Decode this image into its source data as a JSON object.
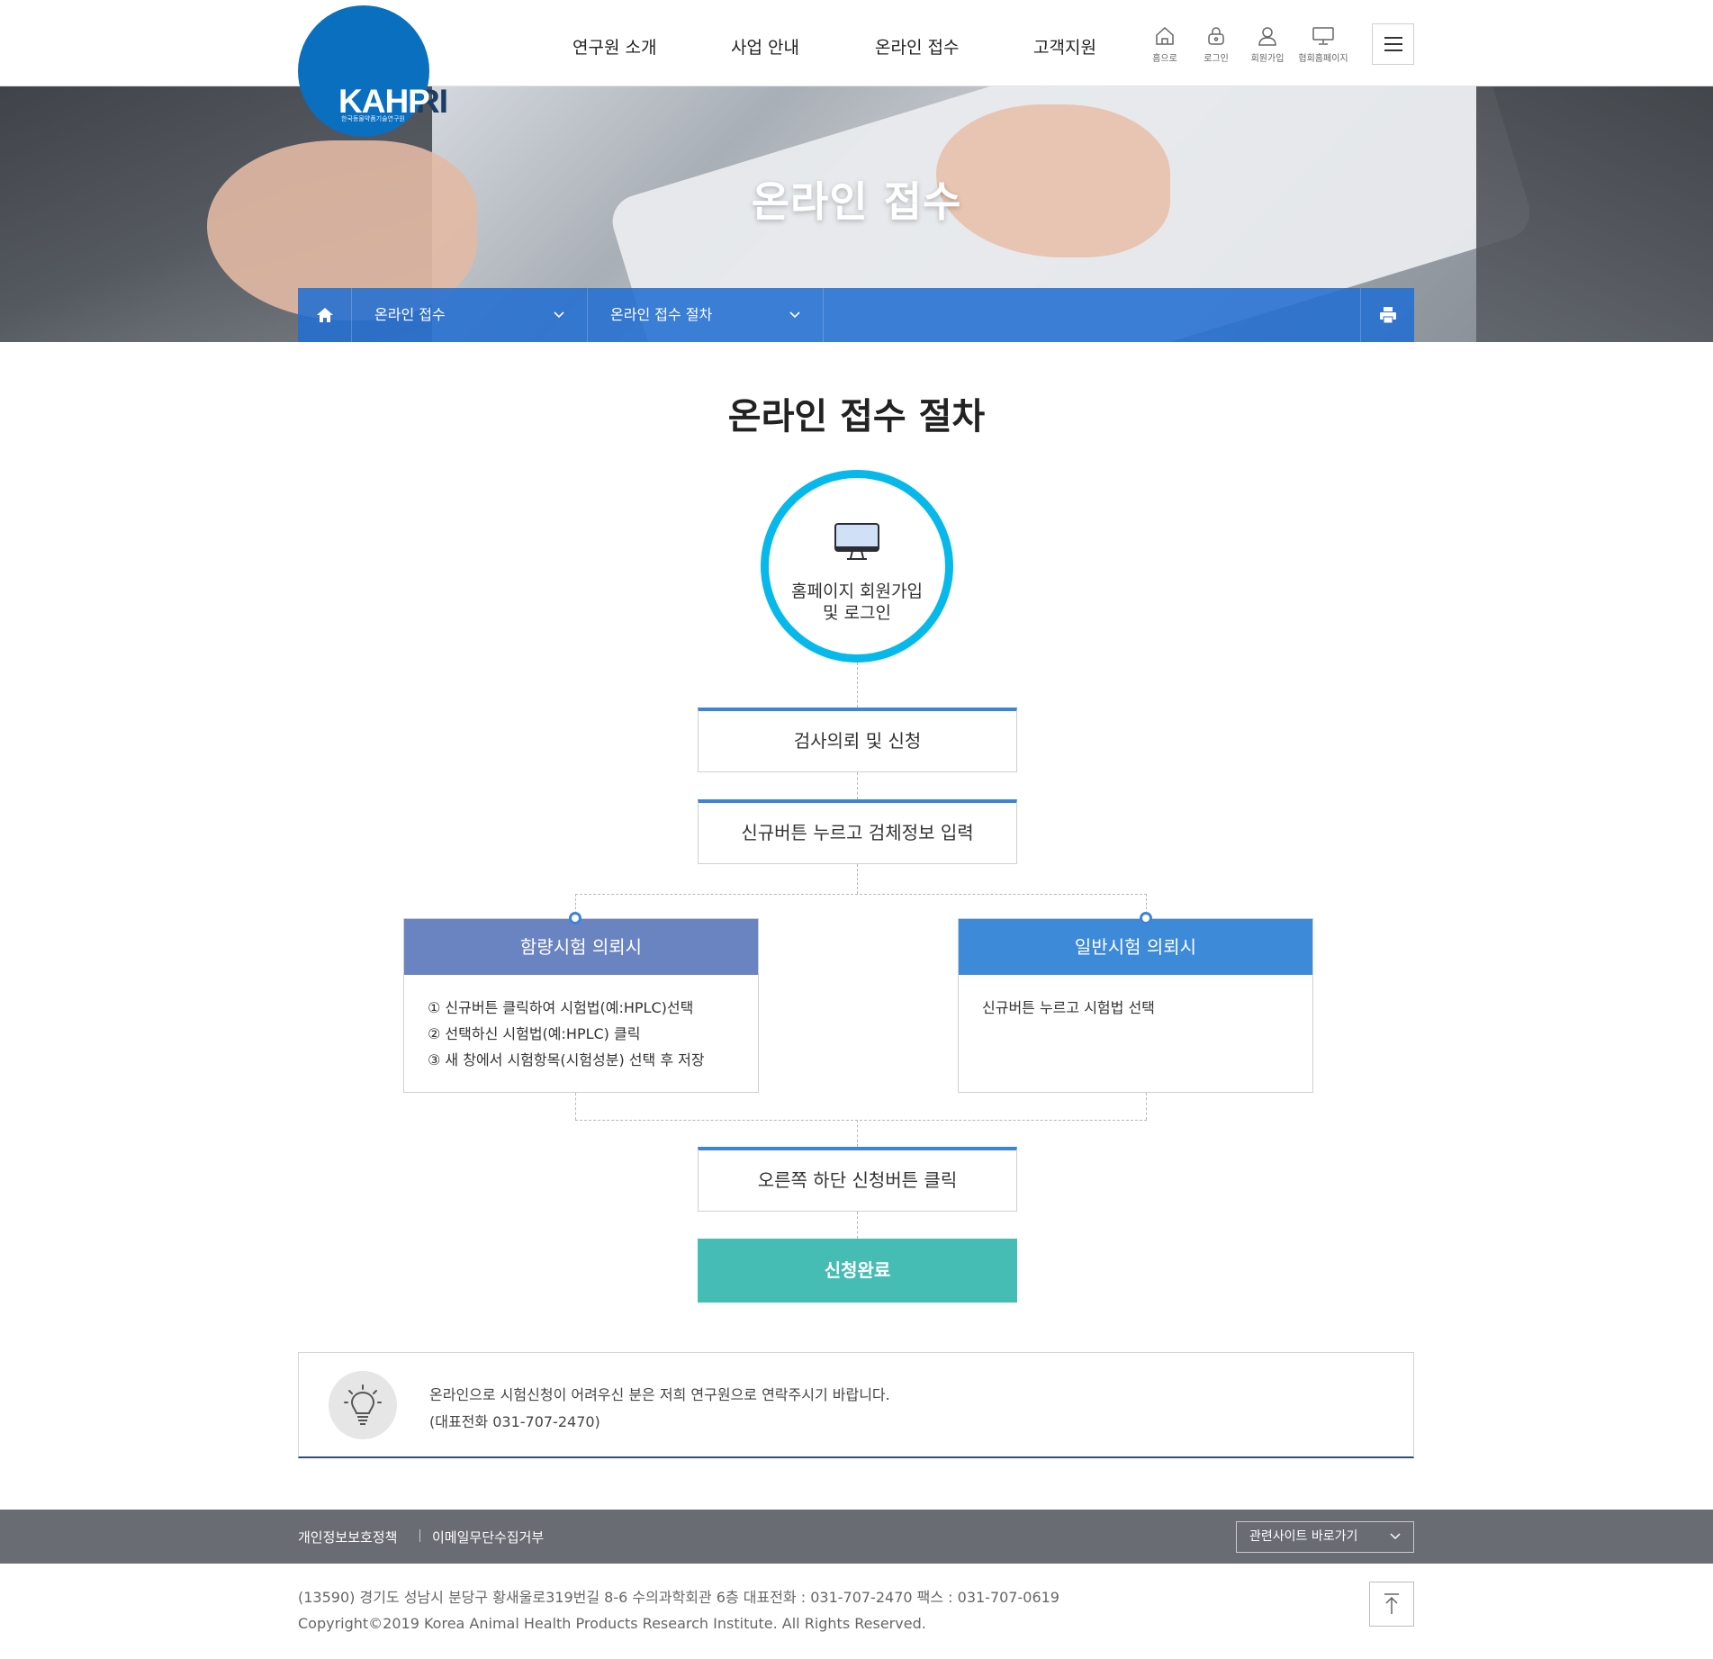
{
  "logo": {
    "text": "KAHPRI",
    "sub": "한국동물약품기술연구원"
  },
  "gnb": [
    "연구원 소개",
    "사업 안내",
    "온라인 접수",
    "고객지원"
  ],
  "util": [
    {
      "label": "홈으로",
      "icon": "home-icon"
    },
    {
      "label": "로그인",
      "icon": "lock-icon"
    },
    {
      "label": "회원가입",
      "icon": "user-icon"
    },
    {
      "label": "협회홈페이지",
      "icon": "monitor-icon"
    }
  ],
  "visual": {
    "title": "온라인 접수"
  },
  "location": {
    "depth1": "온라인 접수",
    "depth2": "온라인 접수 절차"
  },
  "content": {
    "title": "온라인 접수 절차",
    "circle_text_line1": "홈페이지 회원가입",
    "circle_text_line2": "및 로그인",
    "step1": "검사의뢰 및 신청",
    "step2": "신규버튼 누르고 검체정보 입력",
    "branch_left": {
      "title": "함량시험 의뢰시",
      "items": [
        "① 신규버튼 클릭하여 시험법(예:HPLC)선택",
        "② 선택하신 시험법(예:HPLC) 클릭",
        "③ 새 창에서 시험항목(시험성분) 선택 후 저장"
      ]
    },
    "branch_right": {
      "title": "일반시험 의뢰시",
      "items": [
        "신규버튼 누르고 시험법 선택"
      ]
    },
    "step3": "오른쪽 하단 신청버튼 클릭",
    "done": "신청완료"
  },
  "notice": {
    "line1": "온라인으로 시험신청이 어려우신 분은 저희 연구원으로 연락주시기 바랍니다.",
    "line2": "(대표전화 031-707-2470)"
  },
  "footer": {
    "privacy": "개인정보보호정책",
    "email": "이메일무단수집거부",
    "family": "관련사이트 바로가기",
    "address": "(13590) 경기도 성남시 분당구 황새울로319번길 8-6 수의과학회관 6층 대표전화 : 031-707-2470  팩스 : 031-707-0619",
    "copyright": "Copyright©2019 Korea Animal Health Products Research Institute. All Rights Reserved."
  },
  "colors": {
    "primary": "#3d84d6",
    "circle": "#07b8ea",
    "branch_left": "#6a84c2",
    "branch_right": "#3d8ad9",
    "done": "#45bdb4",
    "footer": "#6a6c73"
  }
}
